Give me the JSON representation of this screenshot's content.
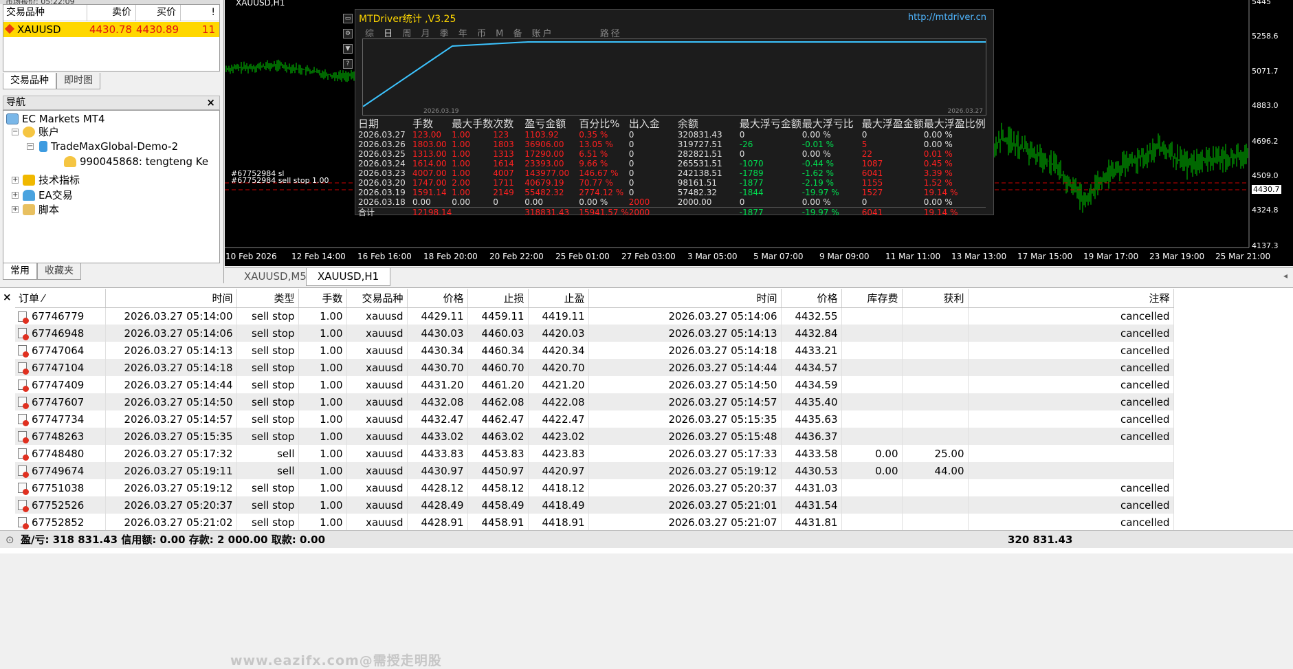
{
  "market_watch": {
    "title_partial": "市场报价: 05:22:09",
    "headers": [
      "交易品种",
      "卖价",
      "买价",
      "!"
    ],
    "row": {
      "symbol": "XAUUSD",
      "bid": "4430.78",
      "ask": "4430.89",
      "spread": "11"
    },
    "tabs": [
      "交易品种",
      "即时图"
    ]
  },
  "navigator": {
    "title": "导航",
    "items": {
      "broker": "EC Markets MT4",
      "accounts": "账户",
      "server": "TradeMaxGlobal-Demo-2",
      "account": "990045868: tengteng Ke",
      "indicators": "技术指标",
      "ea": "EA交易",
      "scripts": "脚本"
    },
    "tabs": [
      "常用",
      "收藏夹"
    ]
  },
  "chart": {
    "symbol_label": "XAUUSD,H1",
    "price_ticks": [
      "5445",
      "5258.6",
      "5071.7",
      "4883.0",
      "4696.2",
      "4509.0",
      "4430.7",
      "4324.8",
      "4137.3"
    ],
    "time_ticks": [
      "10 Feb 2026",
      "12 Feb 14:00",
      "16 Feb 16:00",
      "18 Feb 20:00",
      "20 Feb 22:00",
      "25 Feb 01:00",
      "27 Feb 03:00",
      "3 Mar 05:00",
      "5 Mar 07:00",
      "9 Mar 09:00",
      "11 Mar 11:00",
      "13 Mar 13:00",
      "17 Mar 15:00",
      "19 Mar 17:00",
      "23 Mar 19:00",
      "25 Mar 21:00"
    ],
    "order_labels": [
      "#67752984 sl",
      "#67752984 sell stop 1.00"
    ],
    "colors": {
      "candle": "#00d000",
      "stop_line": "#d00000",
      "bg": "#000000"
    }
  },
  "chart_tabs": [
    "XAUUSD,M5",
    "XAUUSD,H1"
  ],
  "mtdriver": {
    "title": "MTDriver统计 ,V3.25",
    "url": "http://mtdriver.cn",
    "menu": [
      "综",
      "日",
      "周",
      "月",
      "季",
      "年",
      "币",
      "M",
      "备",
      "账户",
      "路径"
    ],
    "chart_dates": [
      "2026.03.19",
      "2026.03.27"
    ],
    "headers": [
      "日期",
      "手数",
      "最大手数",
      "次数",
      "盈亏金额",
      "百分比%",
      "出入金",
      "余额",
      "最大浮亏金额",
      "最大浮亏比",
      "最大浮盈金额",
      "最大浮盈比例"
    ],
    "rows": [
      [
        "2026.03.27",
        "123.00",
        "1.00",
        "123",
        "1103.92",
        "0.35 %",
        "0",
        "320831.43",
        "0",
        "0.00 %",
        "0",
        "0.00 %"
      ],
      [
        "2026.03.26",
        "1803.00",
        "1.00",
        "1803",
        "36906.00",
        "13.05 %",
        "0",
        "319727.51",
        "-26",
        "-0.01 %",
        "5",
        "0.00 %"
      ],
      [
        "2026.03.25",
        "1313.00",
        "1.00",
        "1313",
        "17290.00",
        "6.51 %",
        "0",
        "282821.51",
        "0",
        "0.00 %",
        "22",
        "0.01 %"
      ],
      [
        "2026.03.24",
        "1614.00",
        "1.00",
        "1614",
        "23393.00",
        "9.66 %",
        "0",
        "265531.51",
        "-1070",
        "-0.44 %",
        "1087",
        "0.45 %"
      ],
      [
        "2026.03.23",
        "4007.00",
        "1.00",
        "4007",
        "143977.00",
        "146.67 %",
        "0",
        "242138.51",
        "-1789",
        "-1.62 %",
        "6041",
        "3.39 %"
      ],
      [
        "2026.03.20",
        "1747.00",
        "2.00",
        "1711",
        "40679.19",
        "70.77 %",
        "0",
        "98161.51",
        "-1877",
        "-2.19 %",
        "1155",
        "1.52 %"
      ],
      [
        "2026.03.19",
        "1591.14",
        "1.00",
        "2149",
        "55482.32",
        "2774.12 %",
        "0",
        "57482.32",
        "-1844",
        "-19.97 %",
        "1527",
        "19.14 %"
      ],
      [
        "2026.03.18",
        "0.00",
        "0.00",
        "0",
        "0.00",
        "0.00 %",
        "2000",
        "2000.00",
        "0",
        "0.00 %",
        "0",
        "0.00 %"
      ]
    ],
    "total": [
      "合计",
      "12198.14",
      "",
      "",
      "318831.43",
      "15941.57 %",
      "2000",
      "",
      "-1877",
      "-19.97 %",
      "6041",
      "19.14 %"
    ]
  },
  "orders": {
    "headers": [
      "订单",
      "时间",
      "类型",
      "手数",
      "交易品种",
      "价格",
      "止损",
      "止盈",
      "时间",
      "价格",
      "库存费",
      "获利",
      "注释"
    ],
    "rows": [
      [
        "67746779",
        "2026.03.27 05:14:00",
        "sell stop",
        "1.00",
        "xauusd",
        "4429.11",
        "4459.11",
        "4419.11",
        "2026.03.27 05:14:06",
        "4432.55",
        "",
        "",
        "cancelled"
      ],
      [
        "67746948",
        "2026.03.27 05:14:06",
        "sell stop",
        "1.00",
        "xauusd",
        "4430.03",
        "4460.03",
        "4420.03",
        "2026.03.27 05:14:13",
        "4432.84",
        "",
        "",
        "cancelled"
      ],
      [
        "67747064",
        "2026.03.27 05:14:13",
        "sell stop",
        "1.00",
        "xauusd",
        "4430.34",
        "4460.34",
        "4420.34",
        "2026.03.27 05:14:18",
        "4433.21",
        "",
        "",
        "cancelled"
      ],
      [
        "67747104",
        "2026.03.27 05:14:18",
        "sell stop",
        "1.00",
        "xauusd",
        "4430.70",
        "4460.70",
        "4420.70",
        "2026.03.27 05:14:44",
        "4434.57",
        "",
        "",
        "cancelled"
      ],
      [
        "67747409",
        "2026.03.27 05:14:44",
        "sell stop",
        "1.00",
        "xauusd",
        "4431.20",
        "4461.20",
        "4421.20",
        "2026.03.27 05:14:50",
        "4434.59",
        "",
        "",
        "cancelled"
      ],
      [
        "67747607",
        "2026.03.27 05:14:50",
        "sell stop",
        "1.00",
        "xauusd",
        "4432.08",
        "4462.08",
        "4422.08",
        "2026.03.27 05:14:57",
        "4435.40",
        "",
        "",
        "cancelled"
      ],
      [
        "67747734",
        "2026.03.27 05:14:57",
        "sell stop",
        "1.00",
        "xauusd",
        "4432.47",
        "4462.47",
        "4422.47",
        "2026.03.27 05:15:35",
        "4435.63",
        "",
        "",
        "cancelled"
      ],
      [
        "67748263",
        "2026.03.27 05:15:35",
        "sell stop",
        "1.00",
        "xauusd",
        "4433.02",
        "4463.02",
        "4423.02",
        "2026.03.27 05:15:48",
        "4436.37",
        "",
        "",
        "cancelled"
      ],
      [
        "67748480",
        "2026.03.27 05:17:32",
        "sell",
        "1.00",
        "xauusd",
        "4433.83",
        "4453.83",
        "4423.83",
        "2026.03.27 05:17:33",
        "4433.58",
        "0.00",
        "25.00",
        ""
      ],
      [
        "67749674",
        "2026.03.27 05:19:11",
        "sell",
        "1.00",
        "xauusd",
        "4430.97",
        "4450.97",
        "4420.97",
        "2026.03.27 05:19:12",
        "4430.53",
        "0.00",
        "44.00",
        ""
      ],
      [
        "67751038",
        "2026.03.27 05:19:12",
        "sell stop",
        "1.00",
        "xauusd",
        "4428.12",
        "4458.12",
        "4418.12",
        "2026.03.27 05:20:37",
        "4431.03",
        "",
        "",
        "cancelled"
      ],
      [
        "67752526",
        "2026.03.27 05:20:37",
        "sell stop",
        "1.00",
        "xauusd",
        "4428.49",
        "4458.49",
        "4418.49",
        "2026.03.27 05:21:01",
        "4431.54",
        "",
        "",
        "cancelled"
      ],
      [
        "67752852",
        "2026.03.27 05:21:02",
        "sell stop",
        "1.00",
        "xauusd",
        "4428.91",
        "4458.91",
        "4418.91",
        "2026.03.27 05:21:07",
        "4431.81",
        "",
        "",
        "cancelled"
      ]
    ],
    "summary": "盈/亏: 318 831.43  信用额: 0.00  存款: 2 000.00  取款: 0.00",
    "summary_total": "320 831.43",
    "watermark": "www.eazifx.com@需授走明股"
  }
}
